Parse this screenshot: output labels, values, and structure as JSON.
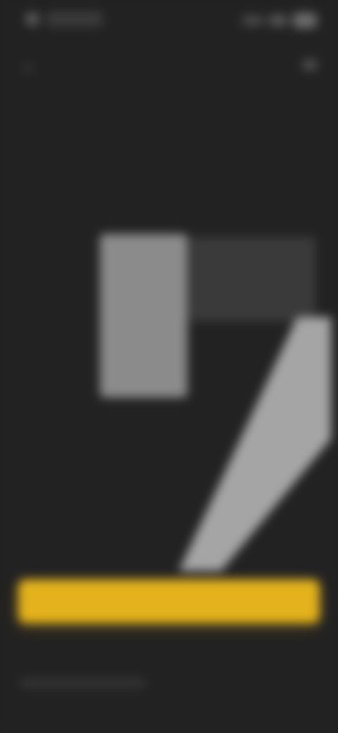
{
  "status_bar": {
    "time": "",
    "signal": "",
    "battery": ""
  },
  "header": {
    "back_icon": "back-icon",
    "menu_icon": "menu-icon"
  },
  "hero": {
    "title": "",
    "subtitle": ""
  },
  "cta": {
    "label": ""
  },
  "footer": {
    "text": ""
  },
  "colors": {
    "background": "#222222",
    "accent": "#e3b21c",
    "title_text": "#e9e9e9"
  }
}
